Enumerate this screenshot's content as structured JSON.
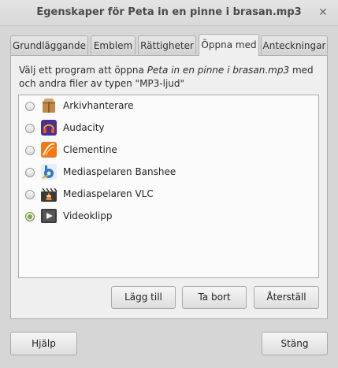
{
  "window": {
    "title": "Egenskaper för Peta in en pinne i brasan.mp3",
    "close_glyph": "✕"
  },
  "tabs": [
    {
      "label": "Grundläggande",
      "active": false
    },
    {
      "label": "Emblem",
      "active": false
    },
    {
      "label": "Rättigheter",
      "active": false
    },
    {
      "label": "Öppna med",
      "active": true
    },
    {
      "label": "Anteckningar",
      "active": false
    }
  ],
  "open_with": {
    "desc_prefix": "Välj ett program att öppna ",
    "desc_file": "Peta in en pinne i brasan.mp3",
    "desc_suffix": " med och andra filer av typen \"MP3-ljud\"",
    "apps": [
      {
        "name": "Arkivhanterare",
        "icon": "archive-manager-icon",
        "selected": false
      },
      {
        "name": "Audacity",
        "icon": "audacity-icon",
        "selected": false
      },
      {
        "name": "Clementine",
        "icon": "clementine-icon",
        "selected": false
      },
      {
        "name": "Mediaspelaren Banshee",
        "icon": "banshee-icon",
        "selected": false
      },
      {
        "name": "Mediaspelaren VLC",
        "icon": "vlc-icon",
        "selected": false
      },
      {
        "name": "Videoklipp",
        "icon": "videos-icon",
        "selected": true
      }
    ],
    "add_label": "Lägg till",
    "remove_label": "Ta bort",
    "reset_label": "Återställ"
  },
  "footer": {
    "help_label": "Hjälp",
    "close_label": "Stäng"
  }
}
